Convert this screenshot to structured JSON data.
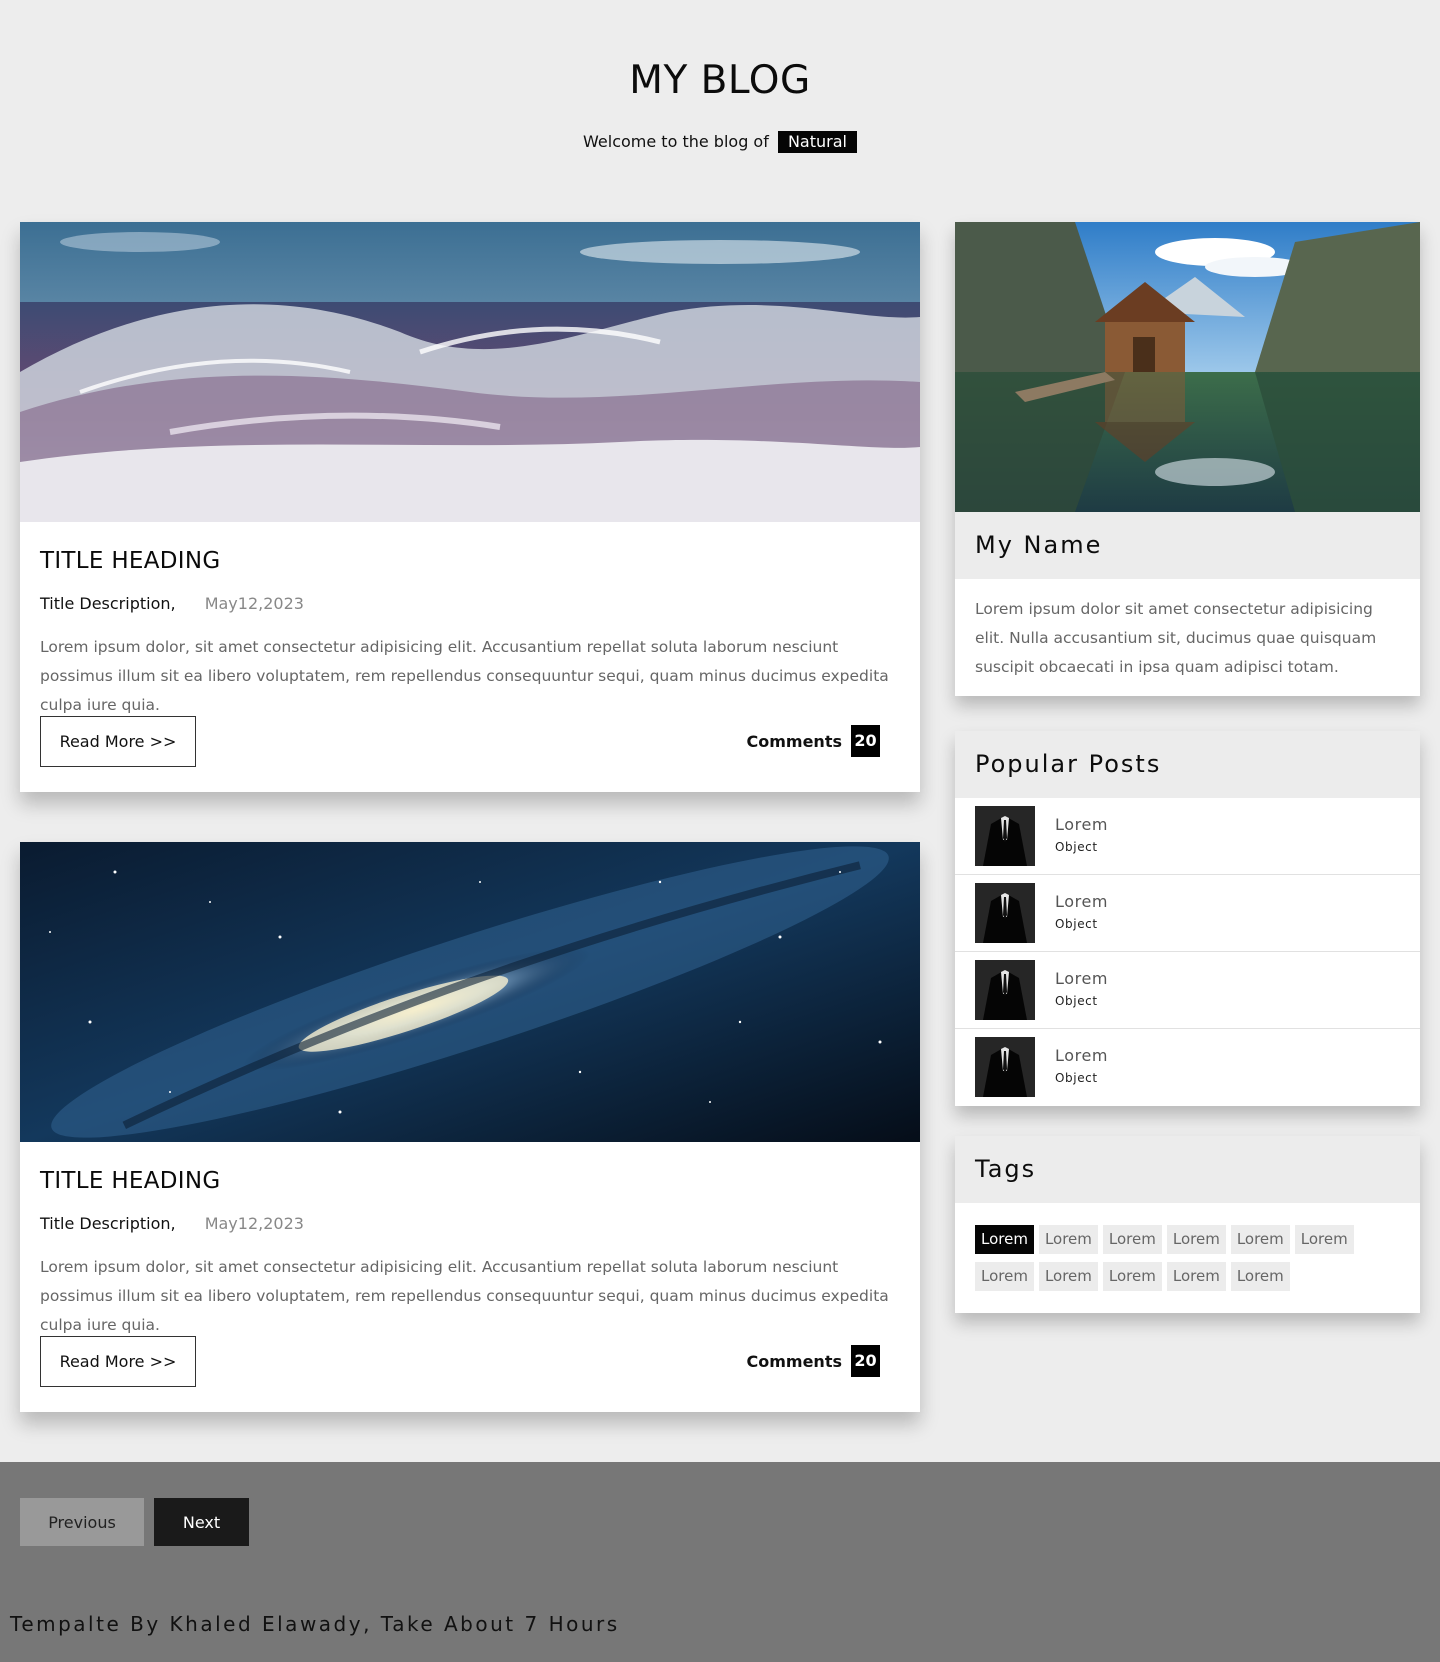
{
  "header": {
    "title": "MY BLOG",
    "subtitle_prefix": "Welcome to the blog of",
    "subtitle_badge": "Natural"
  },
  "posts": [
    {
      "title": "TITLE HEADING",
      "description": "Title Description,",
      "date": "May12,2023",
      "body": "Lorem ipsum dolor, sit amet consectetur adipisicing elit. Accusantium repellat soluta laborum nesciunt possimus illum sit ea libero voluptatem, rem repellendus consequuntur sequi, quam minus ducimus expedita culpa iure quia.",
      "read_more": "Read More >>",
      "comments_label": "Comments",
      "comments_count": "20"
    },
    {
      "title": "TITLE HEADING",
      "description": "Title Description,",
      "date": "May12,2023",
      "body": "Lorem ipsum dolor, sit amet consectetur adipisicing elit. Accusantium repellat soluta laborum nesciunt possimus illum sit ea libero voluptatem, rem repellendus consequuntur sequi, quam minus ducimus expedita culpa iure quia.",
      "read_more": "Read More >>",
      "comments_label": "Comments",
      "comments_count": "20"
    }
  ],
  "sidebar": {
    "about": {
      "name": "My Name",
      "text": "Lorem ipsum dolor sit amet consectetur adipisicing elit. Nulla accusantium sit, ducimus quae quisquam suscipit obcaecati in ipsa quam adipisci totam."
    },
    "popular": {
      "heading": "Popular Posts",
      "items": [
        {
          "title": "Lorem",
          "subtitle": "Object"
        },
        {
          "title": "Lorem",
          "subtitle": "Object"
        },
        {
          "title": "Lorem",
          "subtitle": "Object"
        },
        {
          "title": "Lorem",
          "subtitle": "Object"
        }
      ]
    },
    "tags": {
      "heading": "Tags",
      "items": [
        "Lorem",
        "Lorem",
        "Lorem",
        "Lorem",
        "Lorem",
        "Lorem",
        "Lorem",
        "Lorem",
        "Lorem",
        "Lorem",
        "Lorem"
      ]
    }
  },
  "footer": {
    "previous": "Previous",
    "next": "Next",
    "credit": "Tempalte By Khaled Elawady, Take About 7 Hours"
  },
  "colors": {
    "page_bg": "#ededed",
    "accent": "#050505",
    "footer_bg": "#777777"
  }
}
